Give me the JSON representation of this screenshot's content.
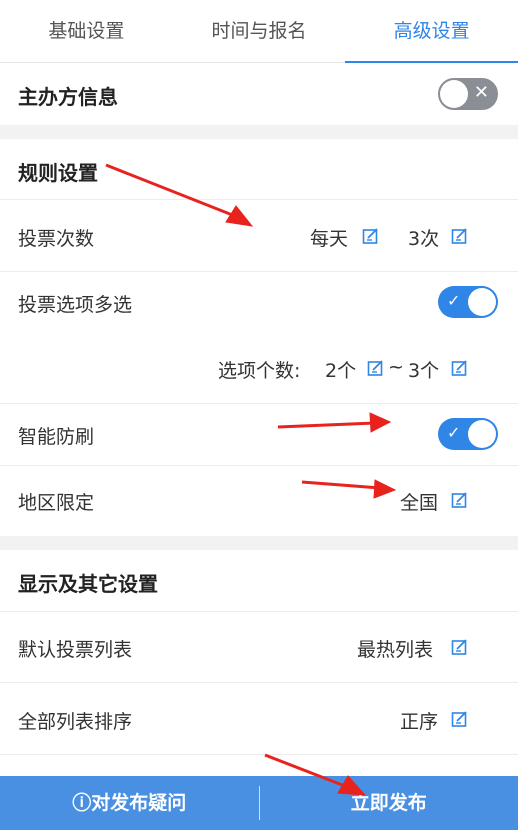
{
  "tabs": [
    {
      "label": "基础设置"
    },
    {
      "label": "时间与报名"
    },
    {
      "label": "高级设置"
    }
  ],
  "organizer": {
    "label": "主办方信息",
    "enabled": false
  },
  "rules": {
    "title": "规则设置",
    "vote_count": {
      "label": "投票次数",
      "period": "每天",
      "times": "3次"
    },
    "multi_select": {
      "label": "投票选项多选",
      "enabled": true,
      "option_count_label": "选项个数:",
      "min": "2个",
      "sep": "~",
      "max": "3个"
    },
    "anti_brush": {
      "label": "智能防刷",
      "enabled": true
    },
    "region": {
      "label": "地区限定",
      "value": "全国"
    }
  },
  "display": {
    "title": "显示及其它设置",
    "default_list": {
      "label": "默认投票列表",
      "value": "最热列表"
    },
    "sort": {
      "label": "全部列表排序",
      "value": "正序"
    }
  },
  "bottom": {
    "help_icon": "ⓘ",
    "help_label": "对发布疑问",
    "publish_label": "立即发布"
  },
  "colors": {
    "accent": "#2f86e6",
    "bar": "#4a90e2",
    "arrow": "#e8231e"
  }
}
